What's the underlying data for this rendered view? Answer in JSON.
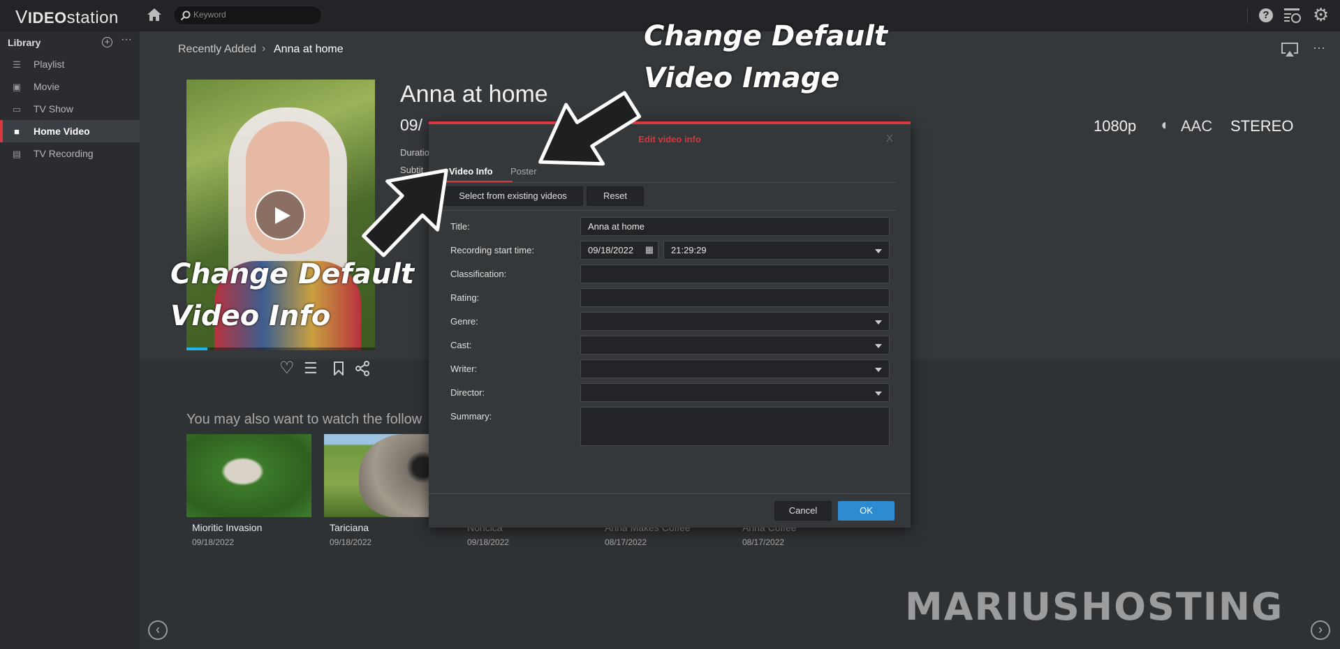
{
  "app": {
    "logo_text": "VIDEOstation",
    "search_placeholder": "Keyword"
  },
  "sidebar": {
    "title": "Library",
    "items": [
      {
        "label": "Playlist",
        "icon": "playlist-icon"
      },
      {
        "label": "Movie",
        "icon": "movie-icon"
      },
      {
        "label": "TV Show",
        "icon": "tv-icon"
      },
      {
        "label": "Home Video",
        "icon": "home-video-icon",
        "active": true
      },
      {
        "label": "TV Recording",
        "icon": "tv-recording-icon"
      }
    ]
  },
  "breadcrumb": {
    "parent": "Recently Added",
    "current": "Anna at home"
  },
  "video": {
    "title": "Anna at home",
    "date": "09/",
    "duration_label": "Duratio",
    "subtitle_label": "Subtit",
    "resolution": "1080p",
    "audio_codec": "AAC",
    "audio_channels": "STEREO",
    "progress_percent": 11
  },
  "recommend": {
    "heading": "You may also want to watch the follow",
    "items": [
      {
        "title": "Mioritic Invasion",
        "date": "09/18/2022"
      },
      {
        "title": "Tariciana",
        "date": "09/18/2022"
      },
      {
        "title": "Noricica",
        "date": "09/18/2022"
      },
      {
        "title": "Anna Makes Coffee",
        "date": "08/17/2022"
      },
      {
        "title": "Anna Coffee",
        "date": "08/17/2022"
      }
    ]
  },
  "dialog": {
    "title": "Edit video info",
    "close": "X",
    "tabs": [
      "Video Info",
      "Poster"
    ],
    "select_button": "Select from existing videos",
    "reset_button": "Reset",
    "fields": {
      "title_label": "Title:",
      "title_value": "Anna at home",
      "recording_label": "Recording start time:",
      "date_value": "09/18/2022",
      "time_value": "21:29:29",
      "classification_label": "Classification:",
      "rating_label": "Rating:",
      "genre_label": "Genre:",
      "cast_label": "Cast:",
      "writer_label": "Writer:",
      "director_label": "Director:",
      "summary_label": "Summary:"
    },
    "cancel": "Cancel",
    "ok": "OK"
  },
  "annotations": {
    "image": [
      "Change Default",
      "Video Image"
    ],
    "info": [
      "Change Default",
      "Video Info"
    ]
  },
  "watermark": "MARIUSHOSTING",
  "colors": {
    "accent": "#d9363e",
    "ok": "#2f8bd0",
    "progress": "#1fb6e8"
  }
}
